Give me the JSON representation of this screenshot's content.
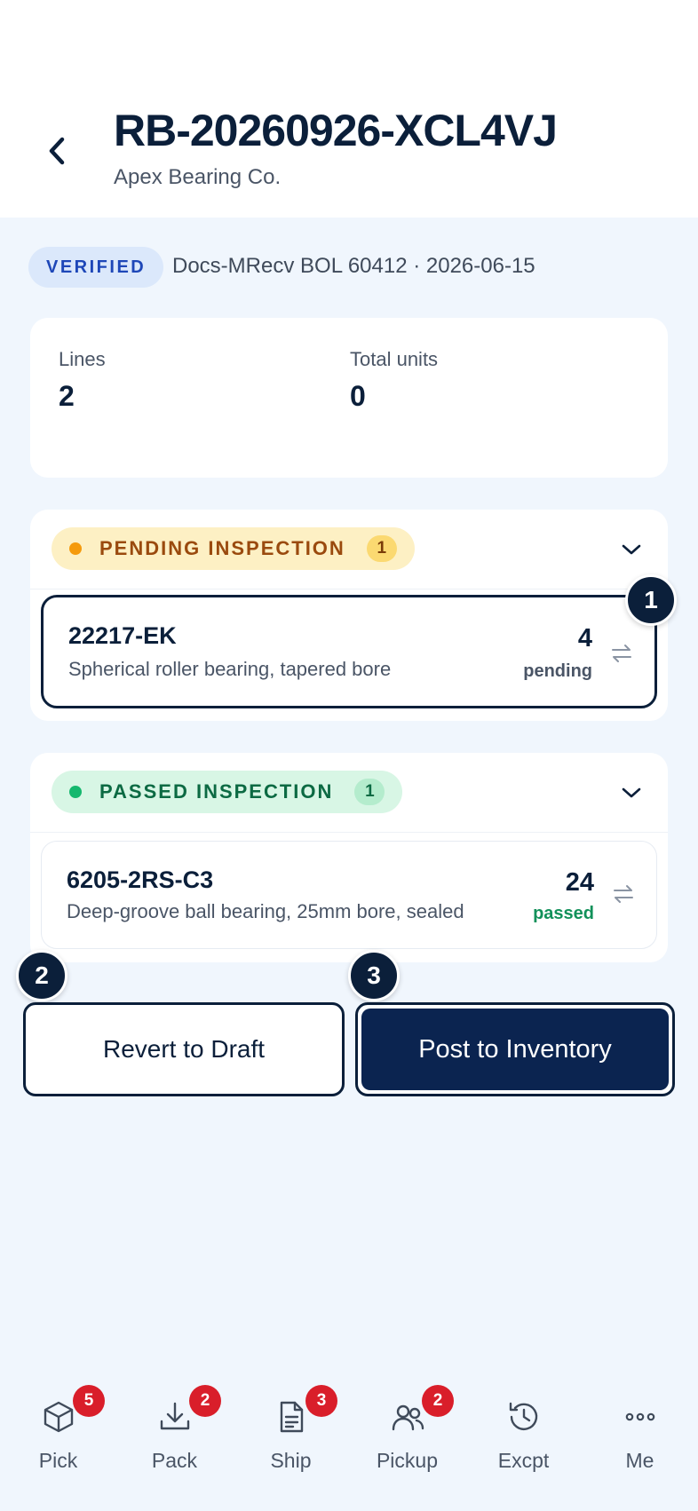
{
  "header": {
    "title": "RB-20260926-XCL4VJ",
    "subtitle": "Apex Bearing Co."
  },
  "verification": {
    "badge": "VERIFIED",
    "reference": "Docs-MRecv BOL 60412 · 2026-06-15"
  },
  "summary": {
    "lines_label": "Lines",
    "lines_value": "2",
    "units_label": "Total units",
    "units_value": "0"
  },
  "groups": [
    {
      "status": "PENDING INSPECTION",
      "count": "1",
      "items": [
        {
          "sku": "22217-EK",
          "description": "Spherical roller bearing, tapered bore",
          "qty": "4",
          "qty_status": "pending"
        }
      ]
    },
    {
      "status": "PASSED INSPECTION",
      "count": "1",
      "items": [
        {
          "sku": "6205-2RS-C3",
          "description": "Deep-groove ball bearing, 25mm bore, sealed",
          "qty": "24",
          "qty_status": "passed"
        }
      ]
    }
  ],
  "markers": [
    "1",
    "2",
    "3"
  ],
  "actions": {
    "revert_label": "Revert to Draft",
    "post_label": "Post to Inventory"
  },
  "nav": [
    {
      "label": "Pick",
      "icon": "box-icon",
      "badge": "5"
    },
    {
      "label": "Pack",
      "icon": "download-tray-icon",
      "badge": "2"
    },
    {
      "label": "Ship",
      "icon": "document-icon",
      "badge": "3"
    },
    {
      "label": "Pickup",
      "icon": "users-icon",
      "badge": "2"
    },
    {
      "label": "Excpt",
      "icon": "history-icon",
      "badge": ""
    },
    {
      "label": "Me",
      "icon": "more-dots-icon",
      "badge": ""
    }
  ],
  "colors": {
    "primary": "#0b1f3a",
    "post_button": "#0b2450",
    "background": "#f0f6fd",
    "badge_red": "#d91e2a",
    "pending": "#f59a0c",
    "passed": "#15b86e"
  }
}
